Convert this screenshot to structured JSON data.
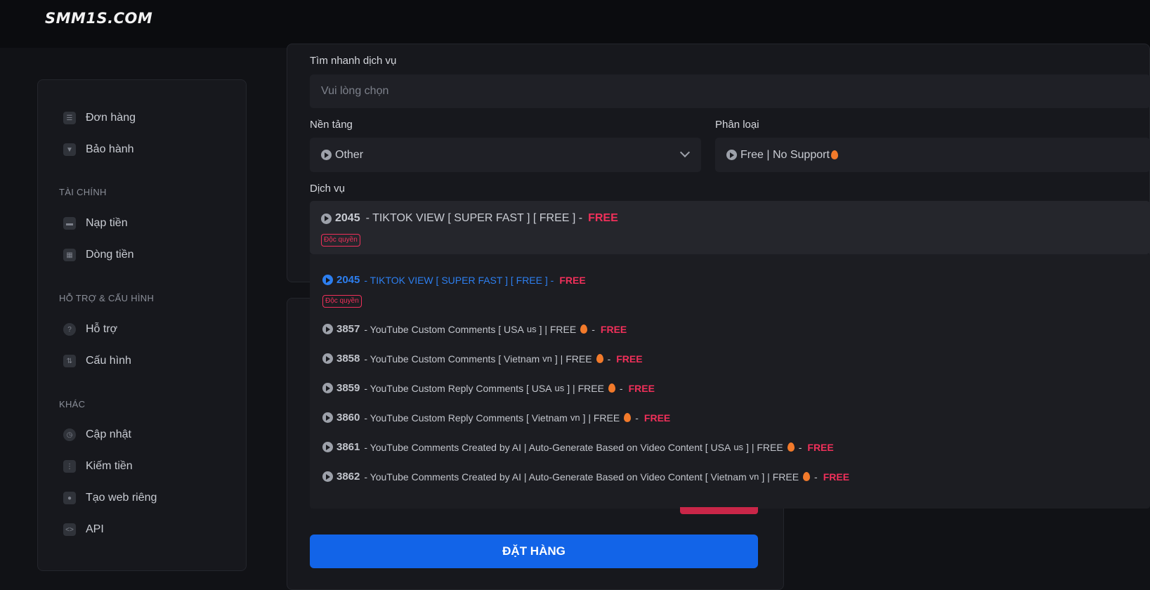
{
  "brand": "SMM1S.COM",
  "sidebar": {
    "items_top": [
      {
        "label": "Đơn hàng",
        "icon": "list-icon"
      },
      {
        "label": "Bảo hành",
        "icon": "filter-icon"
      }
    ],
    "finance": {
      "heading": "TÀI CHÍNH",
      "items": [
        {
          "label": "Nạp tiền",
          "icon": "card-icon"
        },
        {
          "label": "Dòng tiền",
          "icon": "calculator-icon"
        }
      ]
    },
    "support": {
      "heading": "HỖ TRỢ & CẤU HÌNH",
      "items": [
        {
          "label": "Hỗ trợ",
          "icon": "help-icon"
        },
        {
          "label": "Cấu hình",
          "icon": "sliders-icon"
        }
      ]
    },
    "other": {
      "heading": "KHÁC",
      "items": [
        {
          "label": "Cập nhật",
          "icon": "clock-icon"
        },
        {
          "label": "Kiếm tiền",
          "icon": "network-icon"
        },
        {
          "label": "Tạo web riêng",
          "icon": "users-icon"
        },
        {
          "label": "API",
          "icon": "code-icon"
        }
      ]
    }
  },
  "form": {
    "quick_search": {
      "label": "Tìm nhanh dịch vụ",
      "placeholder": "Vui lòng chọn"
    },
    "platform": {
      "label": "Nền tảng",
      "value": "Other"
    },
    "category": {
      "label": "Phân loại",
      "value": "Free | No Support"
    },
    "service": {
      "label": "Dịch vụ",
      "selected": {
        "id": "2045",
        "name": "- TIKTOK VIEW [ SUPER FAST ] [ FREE ] -",
        "price": "FREE",
        "badge": "Độc quyền"
      }
    },
    "submit_label": "ĐẶT HÀNG"
  },
  "dropdown_options": [
    {
      "id": "2045",
      "name": "- TIKTOK VIEW [ SUPER FAST ] [ FREE ] -",
      "price": "FREE",
      "badge": "Độc quyền",
      "active": true
    },
    {
      "id": "3857",
      "name": "- YouTube Custom Comments [ USA",
      "flag": "us",
      "tail": "] | FREE",
      "price": "FREE"
    },
    {
      "id": "3858",
      "name": "- YouTube Custom Comments [ Vietnam",
      "flag": "vn",
      "tail": "] | FREE",
      "price": "FREE"
    },
    {
      "id": "3859",
      "name": "- YouTube Custom Reply Comments [ USA",
      "flag": "us",
      "tail": "] | FREE",
      "price": "FREE"
    },
    {
      "id": "3860",
      "name": "- YouTube Custom Reply Comments [ Vietnam",
      "flag": "vn",
      "tail": "] | FREE",
      "price": "FREE"
    },
    {
      "id": "3861",
      "name": "- YouTube Comments Created by AI | Auto-Generate Based on Video Content [ USA",
      "flag": "us",
      "tail": "] | FREE",
      "price": "FREE"
    },
    {
      "id": "3862",
      "name": "- YouTube Comments Created by AI | Auto-Generate Based on Video Content [ Vietnam",
      "flag": "vn",
      "tail": "] | FREE",
      "price": "FREE"
    }
  ]
}
